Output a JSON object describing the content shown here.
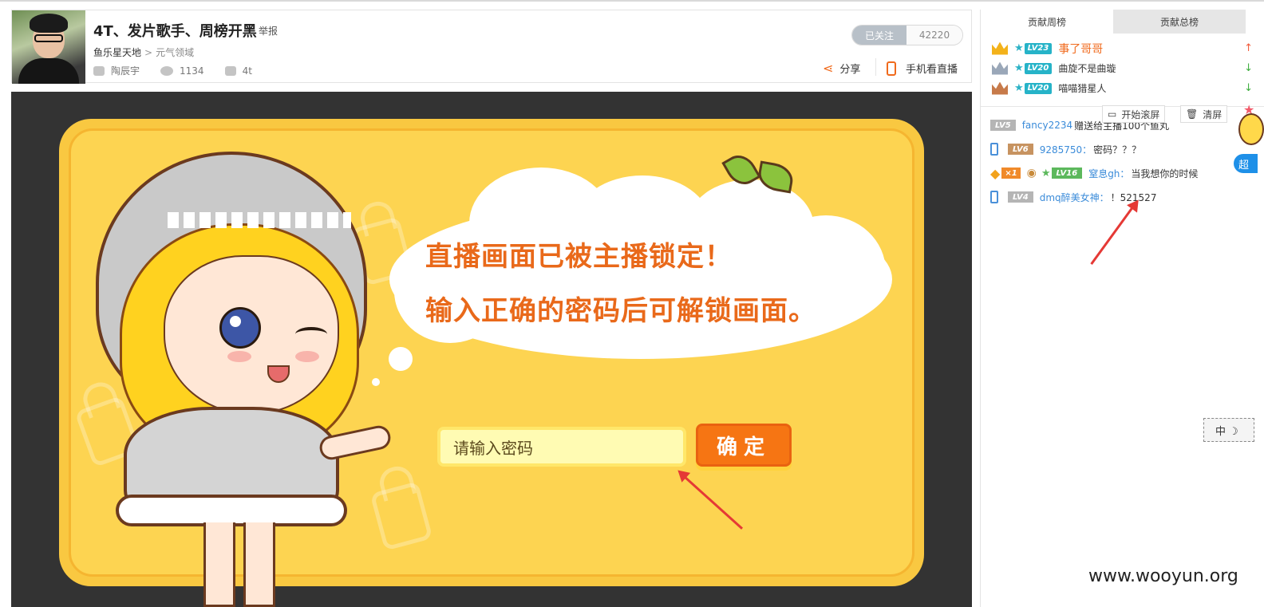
{
  "header": {
    "title": "4T、发片歌手、周榜开黑",
    "report": "举报",
    "breadcrumb": [
      "鱼乐星天地",
      ">",
      "元气领域"
    ],
    "streamer": "陶辰宇",
    "viewers": "1134",
    "tag": "4t",
    "follow_label": "已关注",
    "follow_count": "42220",
    "share_label": "分享",
    "mobile_label": "手机看直播"
  },
  "player": {
    "lock_line1": "直播画面已被主播锁定！",
    "lock_line2": "输入正确的密码后可解锁画面。",
    "password_placeholder": "请输入密码",
    "confirm_label": "确定",
    "colors": {
      "panel": "#f9c841",
      "button": "#f67513",
      "text": "#e9691a"
    }
  },
  "sidebar": {
    "tabs": [
      "贡献周榜",
      "贡献总榜"
    ],
    "ranking": [
      {
        "level": "LV23",
        "name": "事了哥哥",
        "trend": "up",
        "crown": "gold",
        "trend_icon": "↑"
      },
      {
        "level": "LV20",
        "name": "曲旋不是曲璇",
        "trend": "down",
        "crown": "silver",
        "trend_icon": "↓"
      },
      {
        "level": "LV20",
        "name": "喵喵猎星人",
        "trend": "down",
        "crown": "bronze",
        "trend_icon": "↓"
      }
    ],
    "controls": {
      "scroll": "开始滚屏",
      "clear": "清屏"
    },
    "messages": [
      {
        "level": "LV5",
        "user": "fancy2234",
        "text": "赠送给主播100个鱼丸"
      },
      {
        "level": "LV6",
        "user": "9285750：",
        "text": "密码？？？"
      },
      {
        "badge": "×1",
        "level": "LV16",
        "user": "窒息gh：",
        "text": "当我想你的时候"
      },
      {
        "level": "LV4",
        "user": "dmq醉美女神：",
        "text": "！521527"
      }
    ],
    "float_label": "超",
    "ime_label": "中 ☽"
  },
  "watermark": "www.wooyun.org"
}
